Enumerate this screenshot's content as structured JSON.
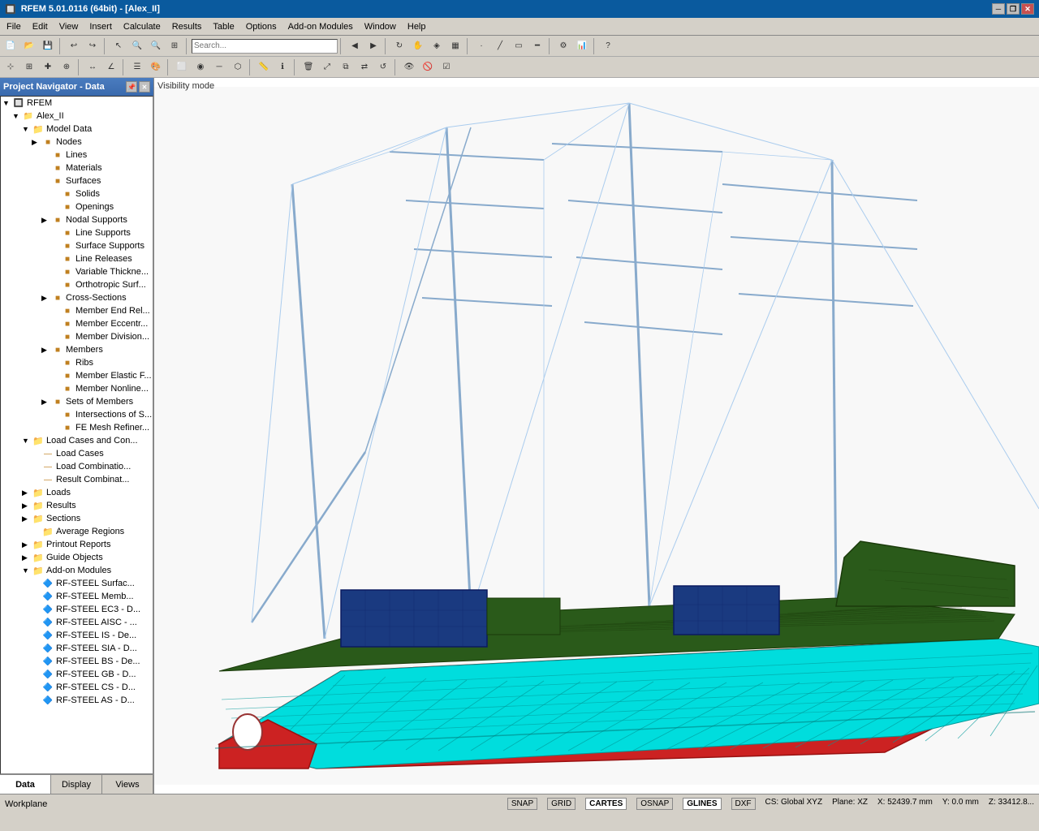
{
  "titlebar": {
    "title": "RFEM 5.01.0116 (64bit) - [Alex_II]",
    "btn_min": "─",
    "btn_max": "□",
    "btn_close": "✕",
    "btn_restore": "❐"
  },
  "menubar": {
    "items": [
      "File",
      "Edit",
      "View",
      "Insert",
      "Calculate",
      "Results",
      "Table",
      "Options",
      "Add-on Modules",
      "Window",
      "Help"
    ]
  },
  "panel": {
    "title": "Project Navigator - Data",
    "tabs": [
      "Data",
      "Display",
      "Views"
    ]
  },
  "tree": {
    "root": "RFEM",
    "project": "Alex_II",
    "model_data": "Model Data",
    "nodes": "Nodes",
    "lines": "Lines",
    "materials": "Materials",
    "surfaces": "Surfaces",
    "solids": "Solids",
    "openings": "Openings",
    "nodal_supports": "Nodal Supports",
    "line_supports": "Line Supports",
    "surface_supports": "Surface Supports",
    "line_releases": "Line Releases",
    "variable_thickness": "Variable Thickne...",
    "orthotropic_surf": "Orthotropic Surf...",
    "cross_sections": "Cross-Sections",
    "member_end_rel": "Member End Rel...",
    "member_eccentr": "Member Eccentr...",
    "member_division": "Member Division...",
    "members": "Members",
    "ribs": "Ribs",
    "member_elastic": "Member Elastic F...",
    "member_nonline": "Member Nonline...",
    "sets_of_members": "Sets of Members",
    "intersections": "Intersections of S...",
    "fe_mesh_refiner": "FE Mesh Refiner...",
    "load_cases_con": "Load Cases and Con...",
    "load_cases": "Load Cases",
    "load_combinations": "Load Combinatio...",
    "result_combinations": "Result Combinat...",
    "loads": "Loads",
    "results": "Results",
    "sections": "Sections",
    "average_regions": "Average Regions",
    "printout_reports": "Printout Reports",
    "guide_objects": "Guide Objects",
    "addon_modules": "Add-on Modules",
    "rf_steel_surface": "RF-STEEL Surfac...",
    "rf_steel_memb": "RF-STEEL Memb...",
    "rf_steel_ec3": "RF-STEEL EC3 - D...",
    "rf_steel_aisc": "RF-STEEL AISC - ...",
    "rf_steel_is": "RF-STEEL IS - De...",
    "rf_steel_sia": "RF-STEEL SIA - D...",
    "rf_steel_bs": "RF-STEEL BS - De...",
    "rf_steel_gb": "RF-STEEL GB - D...",
    "rf_steel_cs": "RF-STEEL CS - D...",
    "rf_steel_as": "RF-STEEL AS - D..."
  },
  "statusbar": {
    "workplane": "Workplane",
    "snap": "SNAP",
    "grid": "GRID",
    "cartes": "CARTES",
    "osnap": "OSNAP",
    "glines": "GLINES",
    "dxf": "DXF",
    "cs": "CS: Global XYZ",
    "plane": "Plane: XZ",
    "x_coord": "X: 52439.7 mm",
    "y_coord": "Y: 0.0 mm",
    "z_coord": "Z: 33412.8..."
  },
  "visibility_label": "Visibility mode"
}
